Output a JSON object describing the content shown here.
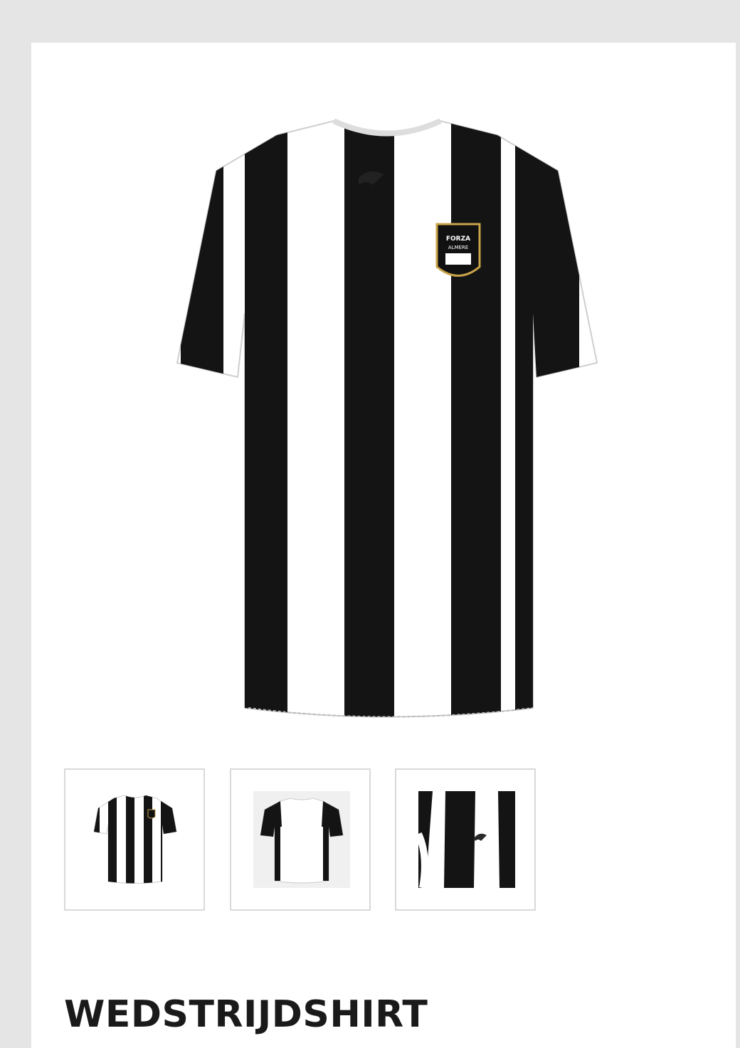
{
  "product": {
    "title": "WEDSTRIJDSHIRT",
    "main_image": {
      "name": "product-main-image",
      "colors": {
        "black": "#141414",
        "white": "#ffffff",
        "crest_gold": "#c9a44a"
      },
      "crest_text": [
        "FORZA",
        "ALMERE"
      ]
    },
    "thumbnails": [
      {
        "name": "thumbnail-front",
        "view": "front"
      },
      {
        "name": "thumbnail-back",
        "view": "back"
      },
      {
        "name": "thumbnail-detail",
        "view": "detail"
      }
    ]
  }
}
